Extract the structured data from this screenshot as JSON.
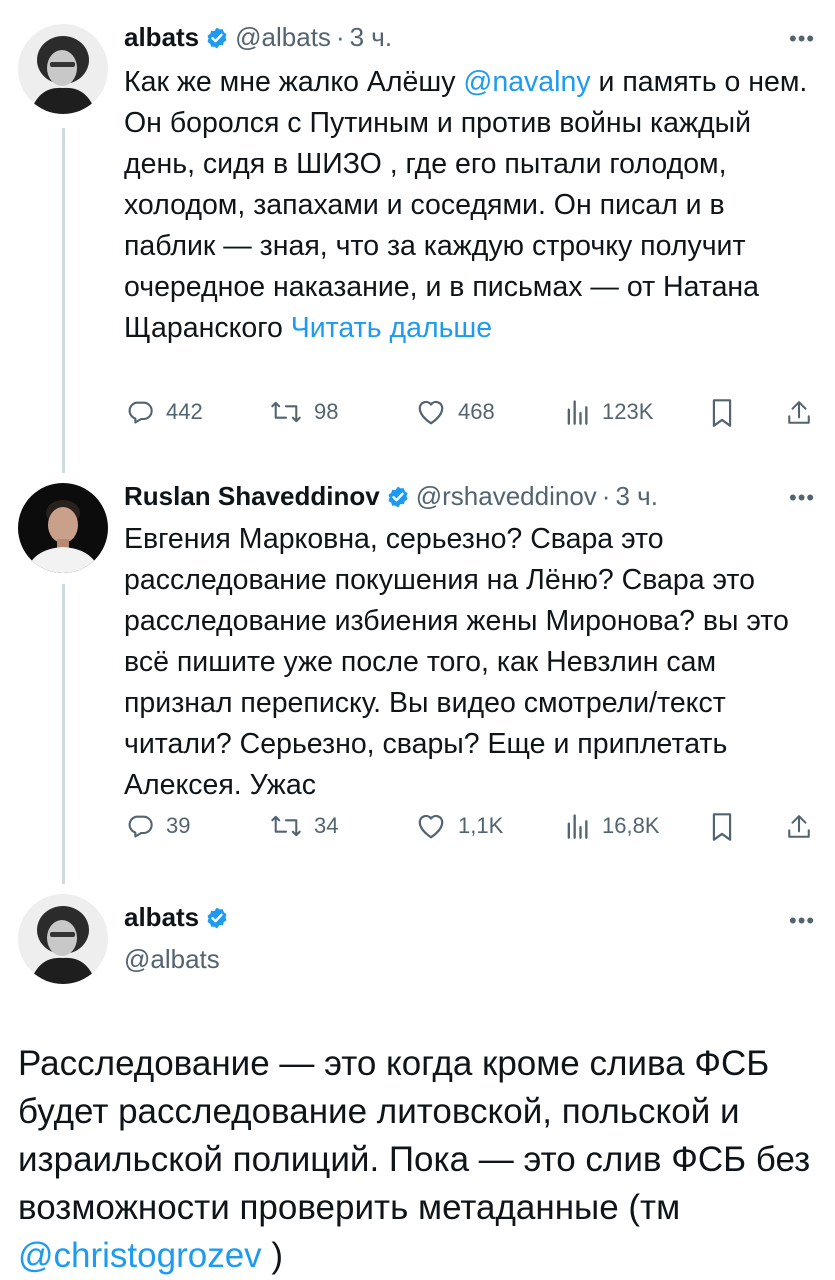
{
  "tweet1": {
    "name": "albats",
    "handle": "@albats",
    "sep": "·",
    "time": "3 ч.",
    "text_a": "Как же мне жалко Алёшу ",
    "mention": "@navalny",
    "text_b": "  и память о нем. Он боролся с Путиным и против войны каждый день, сидя в ШИЗО , где его пытали голодом, холодом, запахами и соседями. Он писал и в паблик — зная, что за каждую строчку получит очередное наказание, и в письмах — от Натана Щаранского ",
    "read_more": "Читать дальше",
    "stats": {
      "replies": "442",
      "reposts": "98",
      "likes": "468",
      "views": "123K"
    }
  },
  "tweet2": {
    "name": "Ruslan Shaveddinov",
    "handle": "@rshaveddinov",
    "sep": "·",
    "time": "3 ч.",
    "text": "Евгения Марковна, серьезно? Свара это расследование покушения на Лёню? Свара это расследование избиения жены Миронова? вы это всё пишите уже после того, как Невзлин сам признал переписку. Вы видео смотрели/текст читали? Серьезно, свары? Еще и приплетать Алексея. Ужас",
    "stats": {
      "replies": "39",
      "reposts": "34",
      "likes": "1,1K",
      "views": "16,8K"
    }
  },
  "tweet3": {
    "name": "albats",
    "handle": "@albats",
    "text": "Расследование  — это когда кроме слива ФСБ будет расследование литовской, польской и израильской полиций. Пока — это слив ФСБ без возможности проверить метаданные (тм ",
    "mention": "@christogrozev",
    "text_end": " )"
  },
  "icons": {
    "reply": "reply-icon",
    "repost": "repost-icon",
    "like": "like-icon",
    "views": "views-icon",
    "bookmark": "bookmark-icon",
    "share": "share-icon",
    "verified": "verified-badge-icon",
    "more": "more-icon"
  },
  "colors": {
    "link": "#1d9bf0",
    "secondary": "#536471",
    "text": "#0f1419",
    "verified": "#1d9bf0"
  }
}
